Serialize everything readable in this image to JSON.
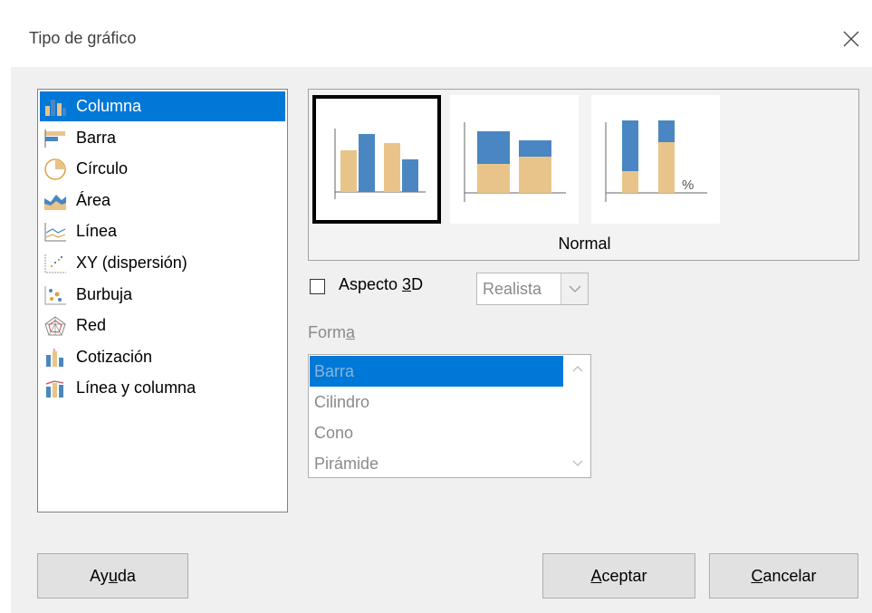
{
  "window": {
    "title": "Tipo de gráfico"
  },
  "chart_types": [
    {
      "label": "Columna",
      "icon": "column-chart-icon",
      "selected": true
    },
    {
      "label": "Barra",
      "icon": "bar-chart-icon"
    },
    {
      "label": "Círculo",
      "icon": "pie-chart-icon"
    },
    {
      "label": "Área",
      "icon": "area-chart-icon"
    },
    {
      "label": "Línea",
      "icon": "line-chart-icon"
    },
    {
      "label": "XY (dispersión)",
      "icon": "scatter-chart-icon"
    },
    {
      "label": "Burbuja",
      "icon": "bubble-chart-icon"
    },
    {
      "label": "Red",
      "icon": "net-chart-icon"
    },
    {
      "label": "Cotización",
      "icon": "stock-chart-icon"
    },
    {
      "label": "Línea y columna",
      "icon": "column-line-chart-icon"
    }
  ],
  "variants": {
    "selected_caption": "Normal",
    "percent_symbol": "%"
  },
  "aspect3d": {
    "label_before": "Aspecto ",
    "label_access": "3",
    "label_after": "D",
    "checked": false,
    "scheme_value": "Realista"
  },
  "shape": {
    "label_before": "Form",
    "label_access": "a",
    "items": [
      "Barra",
      "Cilindro",
      "Cono",
      "Pirámide"
    ],
    "selected": "Barra"
  },
  "buttons": {
    "help_before": "Ay",
    "help_access": "u",
    "help_after": "da",
    "ok_access": "A",
    "ok_after": "ceptar",
    "cancel_access": "C",
    "cancel_after": "ancelar"
  },
  "colors": {
    "selection": "#0078d7",
    "series_a": "#e9c48a",
    "series_b": "#4a86c2"
  }
}
